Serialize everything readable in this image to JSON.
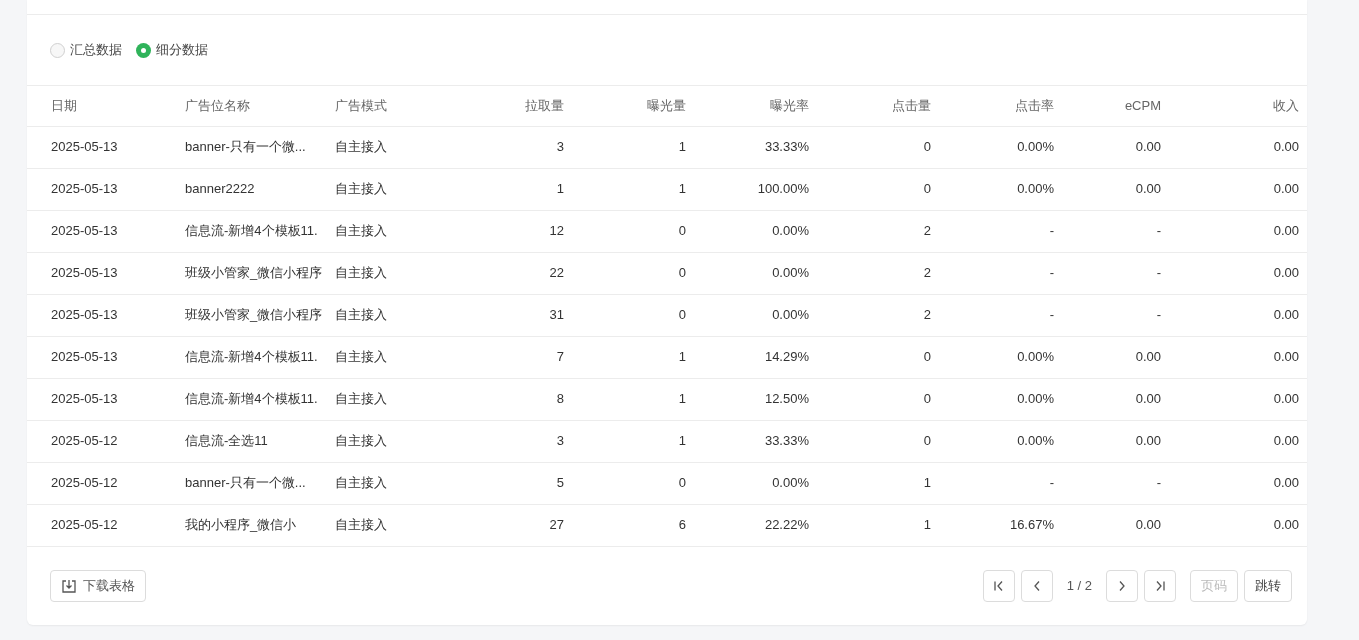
{
  "view_options": [
    {
      "label": "汇总数据",
      "selected": false
    },
    {
      "label": "细分数据",
      "selected": true
    }
  ],
  "table": {
    "columns": [
      "日期",
      "广告位名称",
      "广告模式",
      "拉取量",
      "曝光量",
      "曝光率",
      "点击量",
      "点击率",
      "eCPM",
      "收入"
    ],
    "rows": [
      [
        "2025-05-13",
        "banner-只有一个微...",
        "自主接入",
        "3",
        "1",
        "33.33%",
        "0",
        "0.00%",
        "0.00",
        "0.00"
      ],
      [
        "2025-05-13",
        "banner2222",
        "自主接入",
        "1",
        "1",
        "100.00%",
        "0",
        "0.00%",
        "0.00",
        "0.00"
      ],
      [
        "2025-05-13",
        "信息流-新增4个模板11.",
        "自主接入",
        "12",
        "0",
        "0.00%",
        "2",
        "-",
        "-",
        "0.00"
      ],
      [
        "2025-05-13",
        "班级小管家_微信小程序",
        "自主接入",
        "22",
        "0",
        "0.00%",
        "2",
        "-",
        "-",
        "0.00"
      ],
      [
        "2025-05-13",
        "班级小管家_微信小程序",
        "自主接入",
        "31",
        "0",
        "0.00%",
        "2",
        "-",
        "-",
        "0.00"
      ],
      [
        "2025-05-13",
        "信息流-新增4个模板11.",
        "自主接入",
        "7",
        "1",
        "14.29%",
        "0",
        "0.00%",
        "0.00",
        "0.00"
      ],
      [
        "2025-05-13",
        "信息流-新增4个模板11.",
        "自主接入",
        "8",
        "1",
        "12.50%",
        "0",
        "0.00%",
        "0.00",
        "0.00"
      ],
      [
        "2025-05-12",
        "信息流-全选11",
        "自主接入",
        "3",
        "1",
        "33.33%",
        "0",
        "0.00%",
        "0.00",
        "0.00"
      ],
      [
        "2025-05-12",
        "banner-只有一个微...",
        "自主接入",
        "5",
        "0",
        "0.00%",
        "1",
        "-",
        "-",
        "0.00"
      ],
      [
        "2025-05-12",
        "我的小程序_微信小",
        "自主接入",
        "27",
        "6",
        "22.22%",
        "1",
        "16.67%",
        "0.00",
        "0.00"
      ]
    ]
  },
  "download_button": "下载表格",
  "pagination": {
    "page_info": "1 / 2",
    "page_input": {
      "placeholder": "页码"
    },
    "jump_button": "跳转"
  }
}
